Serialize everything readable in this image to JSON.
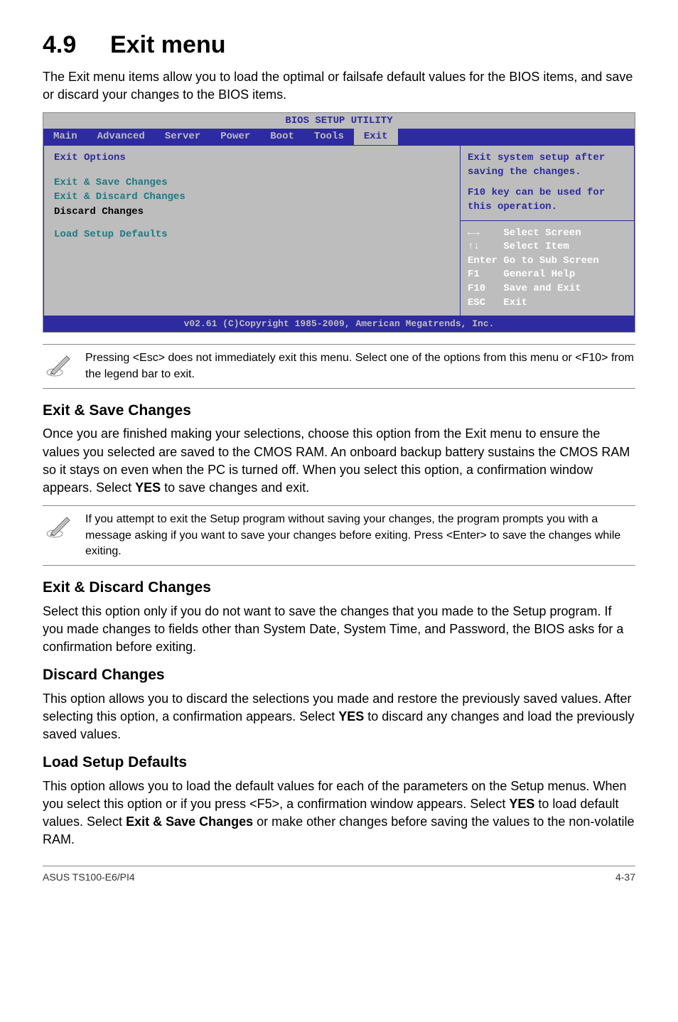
{
  "heading": {
    "num": "4.9",
    "title": "Exit menu"
  },
  "intro": "The Exit menu items allow you to load the optimal or failsafe default values for the BIOS items, and save or discard your changes to the BIOS items.",
  "bios": {
    "title": "BIOS SETUP UTILITY",
    "tabs": [
      "Main",
      "Advanced",
      "Server",
      "Power",
      "Boot",
      "Tools",
      "Exit"
    ],
    "selected_tab": "Exit",
    "group_title": "Exit Options",
    "options": [
      {
        "label": "Exit & Save Changes",
        "cls": "cyan"
      },
      {
        "label": "Exit & Discard Changes",
        "cls": "cyan"
      },
      {
        "label": "Discard Changes",
        "cls": ""
      },
      {
        "label": "Load Setup Defaults",
        "cls": "cyan"
      }
    ],
    "help1": "Exit system setup after saving the changes.",
    "help2": "F10 key can be used for this operation.",
    "keys": [
      "←→    Select Screen",
      "↑↓    Select Item",
      "Enter Go to Sub Screen",
      "F1    General Help",
      "F10   Save and Exit",
      "ESC   Exit"
    ],
    "footer": "v02.61 (C)Copyright 1985-2009, American Megatrends, Inc."
  },
  "note1": "Pressing <Esc> does not immediately exit this menu. Select one of the options from this menu or <F10> from the legend bar to exit.",
  "sec1": {
    "title": "Exit & Save Changes",
    "body": "Once you are finished making your selections, choose this option from the Exit menu to ensure the values you selected are saved to the CMOS RAM. An onboard backup battery sustains the CMOS RAM so it stays on even when the PC is turned off. When you select this option, a confirmation window appears. Select YES to save changes and exit."
  },
  "note2": "If you attempt to exit the Setup program without saving your changes, the program prompts you with a message asking if you want to save your changes before exiting. Press <Enter> to save the changes while exiting.",
  "sec2": {
    "title": "Exit & Discard Changes",
    "body": "Select this option only if you do not want to save the changes that you made to the Setup program. If you made changes to fields other than System Date, System Time, and Password, the BIOS asks for a confirmation before exiting."
  },
  "sec3": {
    "title": "Discard Changes",
    "body": "This option allows you to discard the selections you made and restore the previously saved values. After selecting this option, a confirmation appears. Select YES to discard any changes and load the previously saved values."
  },
  "sec4": {
    "title": "Load Setup Defaults",
    "body": "This option allows you to load the default values for each of the parameters on the Setup menus. When you select this option or if you press <F5>, a confirmation window appears. Select YES to load default values. Select Exit & Save Changes or make other changes before saving the values to the non-volatile RAM."
  },
  "footer": {
    "left": "ASUS TS100-E6/PI4",
    "right": "4-37"
  }
}
